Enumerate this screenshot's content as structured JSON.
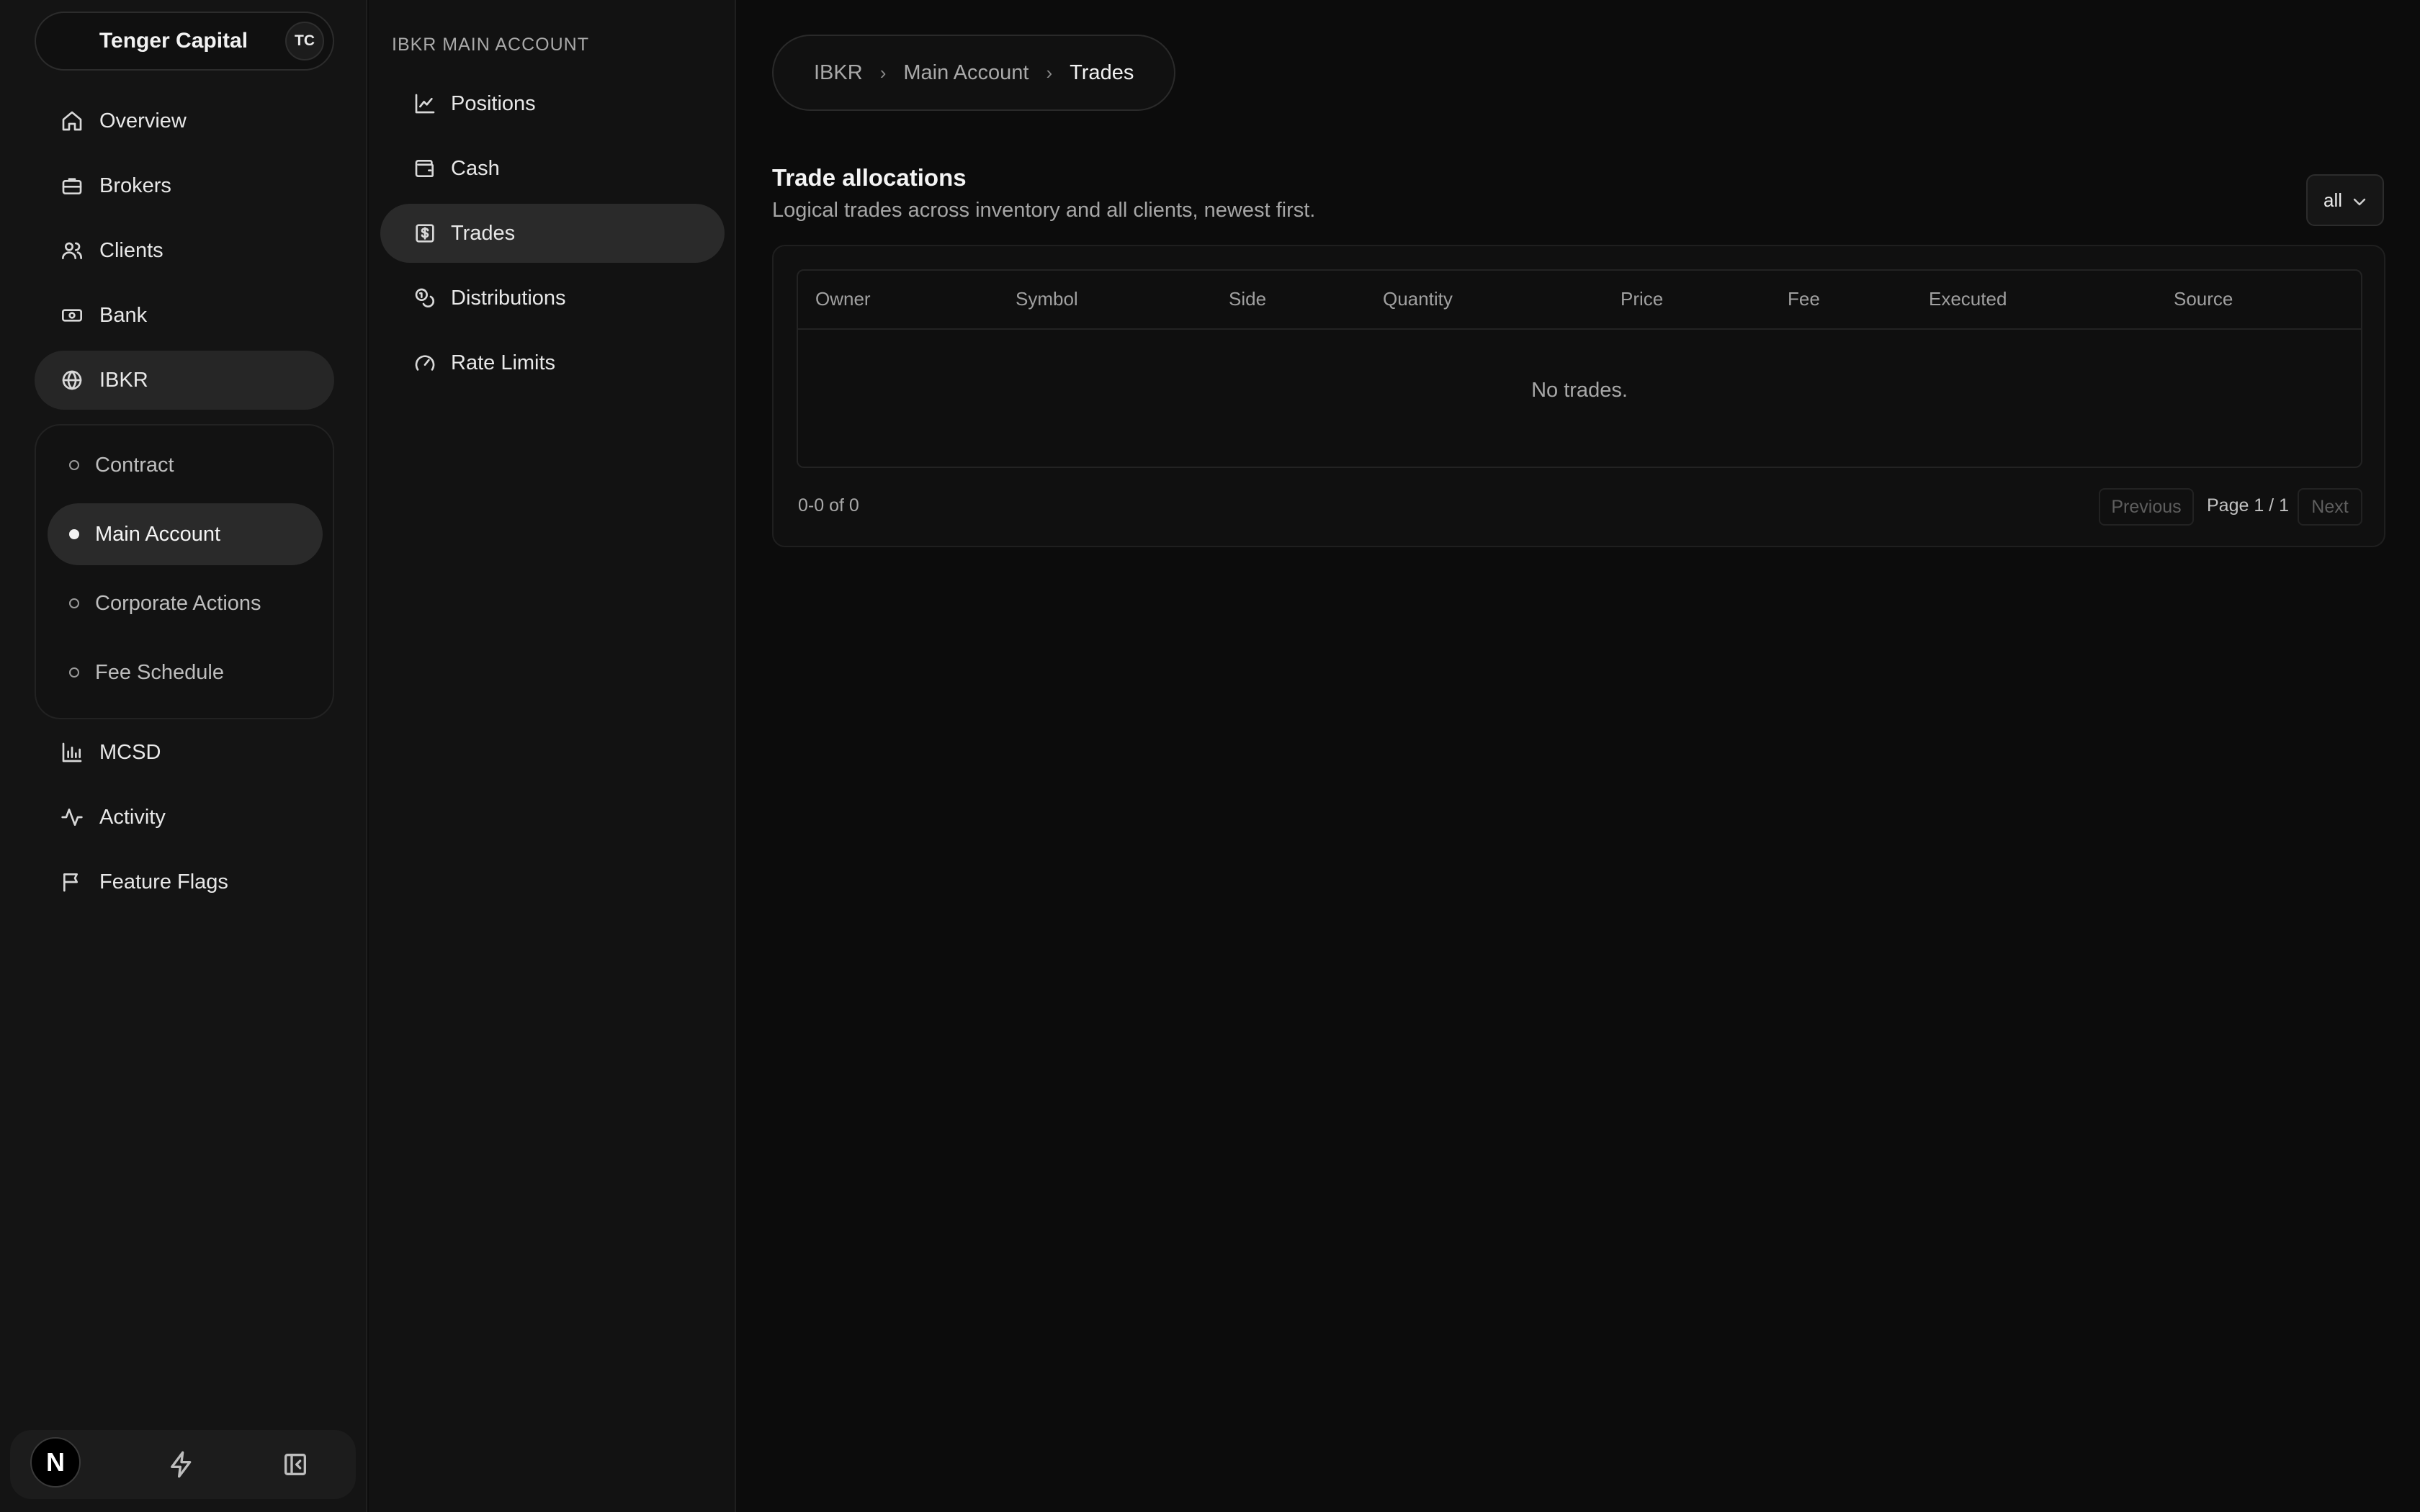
{
  "org": {
    "name": "Tenger Capital",
    "initials": "TC"
  },
  "nav": {
    "overview": "Overview",
    "brokers": "Brokers",
    "clients": "Clients",
    "bank": "Bank",
    "ibkr": "IBKR",
    "ibkr_children": [
      "Contract",
      "Main Account",
      "Corporate Actions",
      "Fee Schedule"
    ],
    "mcsd": "MCSD",
    "activity": "Activity",
    "feature_flags": "Feature Flags"
  },
  "bottom_bar": {
    "logo_letter": "N"
  },
  "subnav": {
    "title": "IBKR MAIN ACCOUNT",
    "items": [
      "Positions",
      "Cash",
      "Trades",
      "Distributions",
      "Rate Limits"
    ]
  },
  "breadcrumb": [
    "IBKR",
    "Main Account",
    "Trades"
  ],
  "section": {
    "title": "Trade allocations",
    "subtitle": "Logical trades across inventory and all clients, newest first."
  },
  "filter": {
    "value": "all"
  },
  "table": {
    "columns": [
      "Owner",
      "Symbol",
      "Side",
      "Quantity",
      "Price",
      "Fee",
      "Executed",
      "Source"
    ],
    "empty_message": "No trades."
  },
  "pagination": {
    "range": "0-0 of 0",
    "previous": "Previous",
    "page": "Page 1 / 1",
    "next": "Next"
  }
}
